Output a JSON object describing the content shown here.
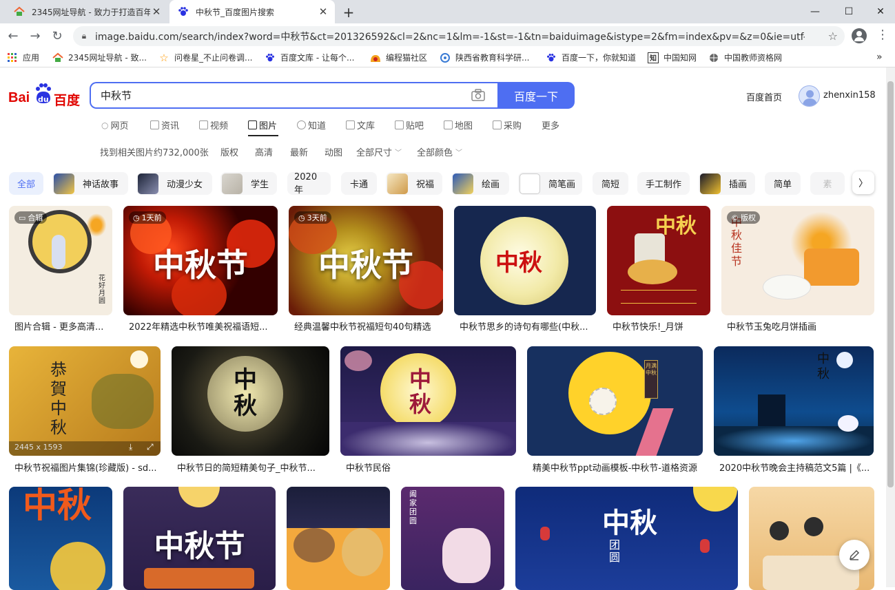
{
  "browser": {
    "tabs": [
      {
        "title": "2345网址导航 - 致力于打造百年",
        "icon": "2345-home-icon"
      },
      {
        "title": "中秋节_百度图片搜索",
        "icon": "baidu-paw-icon"
      }
    ],
    "new_tab": "+",
    "url": "image.baidu.com/search/index?word=中秋节&ct=201326592&cl=2&nc=1&lm=-1&st=-1&tn=baiduimage&istype=2&fm=index&pv=&z=0&ie=utf-8",
    "bookmarks": [
      {
        "label": "应用",
        "icon": "apps-grid-icon"
      },
      {
        "label": "2345网址导航 - 致...",
        "icon": "2345-home-icon"
      },
      {
        "label": "问卷星_不止问卷调...",
        "icon": "star-icon"
      },
      {
        "label": "百度文库 - 让每个...",
        "icon": "baidu-paw-icon"
      },
      {
        "label": "编程猫社区",
        "icon": "cat-icon"
      },
      {
        "label": "陕西省教育科学研...",
        "icon": "org-icon"
      },
      {
        "label": "百度一下，你就知道",
        "icon": "baidu-paw-icon"
      },
      {
        "label": "中国知网",
        "icon": "cnki-icon"
      },
      {
        "label": "中国教师资格网",
        "icon": "globe-icon"
      }
    ],
    "bookmarks_more": "»"
  },
  "header": {
    "logo_text": "百度",
    "logo_latin": "Bai",
    "logo_du": "du",
    "query": "中秋节",
    "search_button": "百度一下",
    "home_link": "百度首页",
    "username": "zhenxin158"
  },
  "nav_tabs": [
    "网页",
    "资讯",
    "视频",
    "图片",
    "知道",
    "文库",
    "贴吧",
    "地图",
    "采购",
    "更多"
  ],
  "active_tab": "图片",
  "filters": {
    "result_count": "找到相关图片约732,000张",
    "items": [
      "版权",
      "高清",
      "最新",
      "动图",
      "全部尺寸",
      "全部颜色"
    ]
  },
  "chips": [
    "全部",
    "神话故事",
    "动漫少女",
    "学生",
    "2020年",
    "卡通",
    "祝福",
    "绘画",
    "简笔画",
    "简短",
    "手工制作",
    "插画",
    "简单",
    "素"
  ],
  "results": {
    "row1": [
      {
        "caption": "图片合辑 - 更多高清...",
        "badge": "合辑"
      },
      {
        "caption": "2022年精选中秋节唯美祝福语短...",
        "badge": "1天前",
        "overlay": "中秋节"
      },
      {
        "caption": "经典温馨中秋节祝福短句40句精选",
        "badge": "3天前",
        "overlay": "中秋节"
      },
      {
        "caption": "中秋节思乡的诗句有哪些(中秋...",
        "overlay": "中秋"
      },
      {
        "caption": "中秋节快乐!_月饼",
        "overlay": "中秋"
      },
      {
        "caption": "中秋节玉兔吃月饼插画",
        "badge": "版权",
        "overlay": "中秋佳节"
      }
    ],
    "row2": [
      {
        "caption": "中秋节祝福图片集锦(珍藏版) - sd...",
        "overlay": "恭賀中秋",
        "size": "2445 x 1593"
      },
      {
        "caption": "中秋节日的简短精美句子_中秋节...",
        "overlay": "中秋"
      },
      {
        "caption": "中秋节民俗",
        "overlay": "中秋"
      },
      {
        "caption": "精美中秋节ppt动画模板-中秋节-道格资源",
        "overlay": "月满中秋"
      },
      {
        "caption": "2020中秋节晚会主持稿范文5篇 |《...",
        "overlay": "中秋"
      }
    ],
    "row3": [
      {
        "overlay": "中秋"
      },
      {
        "overlay": "中秋节"
      },
      {
        "overlay": ""
      },
      {
        "overlay": "阖家团圆"
      },
      {
        "overlay": "中秋",
        "sub": "团圆"
      },
      {
        "overlay": ""
      }
    ]
  },
  "colors": {
    "accent": "#4e6ef2",
    "chrome_bg": "#dee1e6"
  }
}
